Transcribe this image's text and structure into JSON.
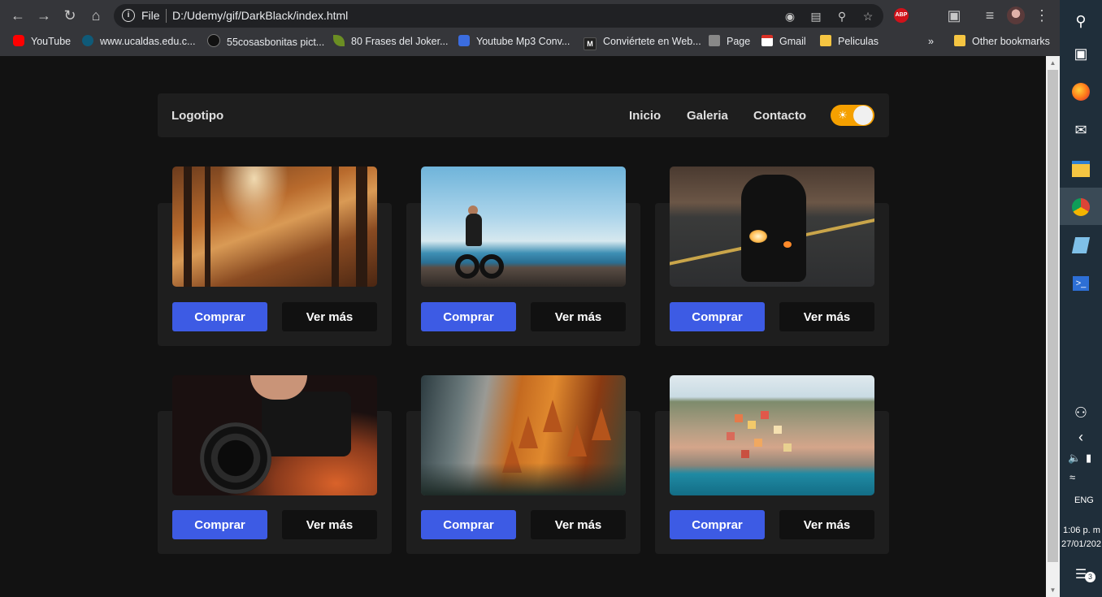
{
  "browser": {
    "url_scheme": "File",
    "url": "D:/Udemy/gif/DarkBlack/index.html",
    "extension_badge": "ABP",
    "bookmarks": [
      {
        "label": "YouTube",
        "icon": "youtube-icon",
        "color": "#ff0000"
      },
      {
        "label": "www.ucaldas.edu.c...",
        "icon": "ucaldas-icon",
        "color": "#0f5a78"
      },
      {
        "label": "55cosasbonitas pict...",
        "icon": "dark-circle-icon",
        "color": "#111111"
      },
      {
        "label": "80 Frases del Joker...",
        "icon": "leaf-icon",
        "color": "#6b8e23"
      },
      {
        "label": "Youtube Mp3 Conv...",
        "icon": "mp3-icon",
        "color": "#3b6de0"
      },
      {
        "label": "Conviértete en Web...",
        "icon": "m-icon",
        "color": "#222222"
      },
      {
        "label": "Page",
        "icon": "page-icon",
        "color": "#888888"
      },
      {
        "label": "Gmail",
        "icon": "gmail-icon",
        "color": "#d93025"
      },
      {
        "label": "Peliculas",
        "icon": "folder-icon",
        "color": "#f5c542"
      }
    ],
    "overflow_chevron": "»",
    "other_bookmarks": "Other bookmarks"
  },
  "navbar": {
    "logo": "Logotipo",
    "links": [
      "Inicio",
      "Galeria",
      "Contacto"
    ],
    "theme_toggle_color": "#f5a000"
  },
  "cards": [
    {
      "image": "forest-path-photo",
      "buy_label": "Comprar",
      "more_label": "Ver más"
    },
    {
      "image": "beach-bike-photo",
      "buy_label": "Comprar",
      "more_label": "Ver más"
    },
    {
      "image": "motorcycle-night-photo",
      "buy_label": "Comprar",
      "more_label": "Ver más"
    },
    {
      "image": "camera-lens-photo",
      "buy_label": "Comprar",
      "more_label": "Ver más"
    },
    {
      "image": "autumn-cliff-photo",
      "buy_label": "Comprar",
      "more_label": "Ver más"
    },
    {
      "image": "coastal-town-photo",
      "buy_label": "Comprar",
      "more_label": "Ver más"
    }
  ],
  "colors": {
    "page_bg": "#121212",
    "surface": "#1e1e1e",
    "buy_button": "#3d5be4",
    "more_button": "#111111"
  },
  "taskbar": {
    "language": "ENG",
    "time": "1:06 p. m",
    "date": "27/01/202",
    "notification_count": "3"
  }
}
